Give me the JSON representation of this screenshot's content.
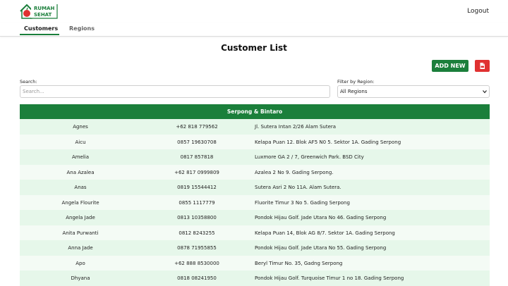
{
  "header": {
    "logo_line1": "RUMAH",
    "logo_line2": "SEHAT",
    "logout_label": "Logout"
  },
  "tabs": [
    {
      "label": "Customers",
      "active": true
    },
    {
      "label": "Regions",
      "active": false
    }
  ],
  "page": {
    "title": "Customer List"
  },
  "toolbar": {
    "add_label": "ADD NEW",
    "pdf_icon": "pdf-file-icon"
  },
  "filters": {
    "search_label": "Search:",
    "search_placeholder": "Search...",
    "region_label": "Filter by Region:",
    "region_selected": "All Regions"
  },
  "colors": {
    "brand_green": "#1b7f3b",
    "pdf_red": "#e03131",
    "row_light": "#e6f7ea"
  },
  "table": {
    "group": "Serpong & Bintaro",
    "rows": [
      {
        "name": "Agnes",
        "phone": "+62 818 779562",
        "address": "Jl. Sutera Intan 2/26 Alam Sutera"
      },
      {
        "name": "Aicu",
        "phone": "0857 19630708",
        "address": "Kelapa Puan 12. Blok AF5 N0 5. Sektor 1A. Gading Serpong"
      },
      {
        "name": "Amelia",
        "phone": "0817 857818",
        "address": "Luxmore GA 2 / 7, Greenwich Park. BSD City"
      },
      {
        "name": "Ana Azalea",
        "phone": "+62 817 0999809",
        "address": "Azalea 2 No 9. Gading Serpong."
      },
      {
        "name": "Anas",
        "phone": "0819 15544412",
        "address": "Sutera Asri 2 No 11A. Alam Sutera."
      },
      {
        "name": "Angela Flourite",
        "phone": "0855 1117779",
        "address": "Fluorite Timur 3 No 5. Gading Serpong"
      },
      {
        "name": "Angela Jade",
        "phone": "0813 10358800",
        "address": "Pondok Hijau Golf. Jade Utara No 46. Gading Serpong"
      },
      {
        "name": "Anita Purwanti",
        "phone": "0812 8243255",
        "address": "Kelapa Puan 14, Blok AG 8/7. Sektor 1A. Gading Serpong"
      },
      {
        "name": "Anna Jade",
        "phone": "0878 71955855",
        "address": "Pondok Hijau Golf. Jade Utara No 55. Gading Serpong"
      },
      {
        "name": "Apo",
        "phone": "+62 888 8530000",
        "address": "Beryl Timur No. 35, Gadng Serpong"
      },
      {
        "name": "Dhyana",
        "phone": "0818 08241950",
        "address": "Pondok Hijau Golf. Turquoise Timur 1 no 18. Gading Serpong"
      }
    ]
  }
}
